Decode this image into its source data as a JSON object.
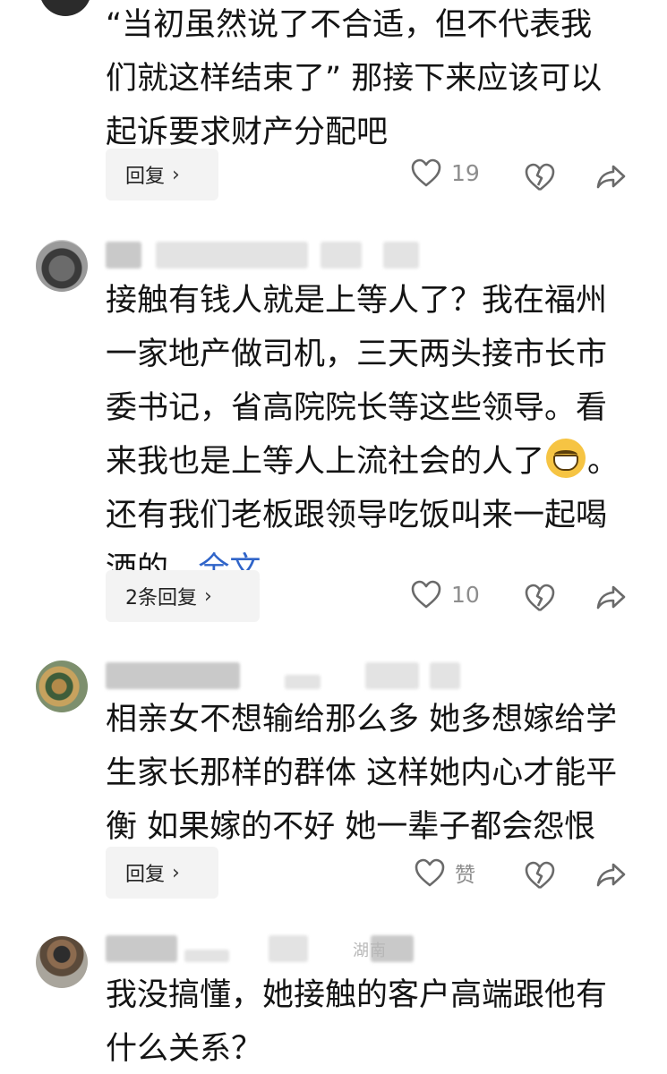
{
  "comments": [
    {
      "content_lines": [
        "“当初虽然说了不合适，但不代表我",
        "们就这样结束了” 那接下来应该可以",
        "起诉要求财产分配吧"
      ],
      "reply_label": "回复",
      "likes": "19"
    },
    {
      "author_hint": "",
      "content_lines": [
        "接触有钱人就是上等人了？我在福州",
        "一家地产做司机，三天两头接市长市",
        "委书记，省高院院长等这些领导。看"
      ],
      "line4_before_emoji": "来我也是上等人上流社会的人了",
      "line4_after_emoji": "。",
      "line5": "还有我们老板跟领导吃饭叫来一起喝",
      "line6_text": "酒的...",
      "full_text_link": "全文",
      "emoji_icon": "grinning-face-emoji",
      "reply_label": "2条回复",
      "likes": "10"
    },
    {
      "author_hint": "",
      "content_lines": [
        "相亲女不想输给那么多 她多想嫁给学",
        "生家长那样的群体 这样她内心才能平",
        "衡 如果嫁的不好 她一辈子都会怨恨"
      ],
      "reply_label": "回复",
      "like_label": "赞"
    },
    {
      "author_hint": "",
      "location_hint": "湖南",
      "content_lines": [
        "我没搞懂，她接触的客户高端跟他有",
        "什么关系？"
      ]
    }
  ],
  "icons": {
    "like": "heart-outline-icon",
    "dislike": "broken-heart-icon",
    "share": "share-arrow-icon",
    "chevron": "chevron-right-icon"
  },
  "colors": {
    "link": "#2f64c9",
    "meta": "#8d8d8d",
    "button_bg": "#f3f3f3"
  }
}
